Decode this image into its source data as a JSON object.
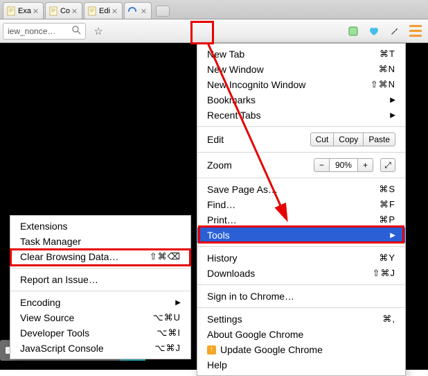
{
  "tabs": [
    {
      "label": "Exa",
      "favicon": "doc"
    },
    {
      "label": "Co",
      "favicon": "doc"
    },
    {
      "label": "Edi",
      "favicon": "doc"
    },
    {
      "label": "",
      "favicon": "spinner"
    }
  ],
  "omnibox": {
    "text": "iew_nonce…"
  },
  "toolbar_icons": [
    "search",
    "star",
    "puzzle",
    "heart",
    "wrench"
  ],
  "main_menu": {
    "new_tab": {
      "label": "New Tab",
      "shortcut": "⌘T"
    },
    "new_window": {
      "label": "New Window",
      "shortcut": "⌘N"
    },
    "incognito": {
      "label": "New Incognito Window",
      "shortcut": "⇧⌘N"
    },
    "bookmarks": {
      "label": "Bookmarks"
    },
    "recent_tabs": {
      "label": "Recent Tabs"
    },
    "edit_label": "Edit",
    "edit_cut": "Cut",
    "edit_copy": "Copy",
    "edit_paste": "Paste",
    "zoom_label": "Zoom",
    "zoom_percent": "90%",
    "save_page": {
      "label": "Save Page As…",
      "shortcut": "⌘S"
    },
    "find": {
      "label": "Find…",
      "shortcut": "⌘F"
    },
    "print": {
      "label": "Print…",
      "shortcut": "⌘P"
    },
    "tools": {
      "label": "Tools"
    },
    "history": {
      "label": "History",
      "shortcut": "⌘Y"
    },
    "downloads": {
      "label": "Downloads",
      "shortcut": "⇧⌘J"
    },
    "signin": {
      "label": "Sign in to Chrome…"
    },
    "settings": {
      "label": "Settings",
      "shortcut": "⌘,"
    },
    "about": {
      "label": "About Google Chrome"
    },
    "update": {
      "label": "Update Google Chrome"
    },
    "help": {
      "label": "Help"
    }
  },
  "tools_submenu": {
    "extensions": {
      "label": "Extensions"
    },
    "task_manager": {
      "label": "Task Manager"
    },
    "clear_data": {
      "label": "Clear Browsing Data…",
      "shortcut": "⇧⌘⌫"
    },
    "report_issue": {
      "label": "Report an Issue…"
    },
    "encoding": {
      "label": "Encoding"
    },
    "view_source": {
      "label": "View Source",
      "shortcut": "⌥⌘U"
    },
    "dev_tools": {
      "label": "Developer Tools",
      "shortcut": "⌥⌘I"
    },
    "js_console": {
      "label": "JavaScript Console",
      "shortcut": "⌥⌘J"
    }
  },
  "annotations": {
    "hamburger_highlight": true,
    "tools_highlight": true,
    "clear_data_highlight": true,
    "arrow_from_hamburger_to_tools": true
  }
}
